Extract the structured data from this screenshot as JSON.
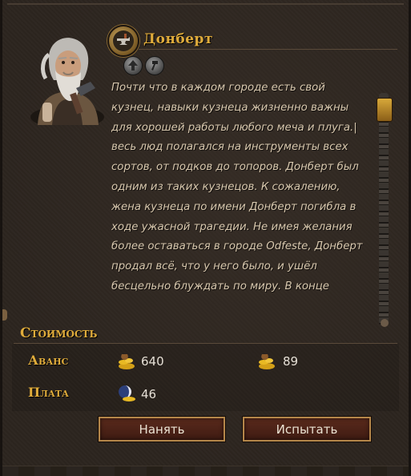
{
  "hero": {
    "name": "Донберт",
    "description": "Почти что в каждом городе есть свой кузнец, навыки кузнеца жизненно важны для хорошей работы любого меча и плуга.| весь люд полагался на инструменты всех сортов, от подков до топоров. Донберт был одним из таких кузнецов. К сожалению, жена кузнеца по имени Донберт погибла в ходе ужасной трагедии. Не имея желания более оставаться в городе Odfeste, Донберт продал всё, что у него было, и ушёл бесцельно блуждать по миру. В конце",
    "icons": [
      "anvil-emblem-icon",
      "upgrade-arrow-skill-icon",
      "hammer-skill-icon"
    ]
  },
  "cost": {
    "title": "Стоимость",
    "advance_label": "Аванс",
    "advance_gold": "640",
    "advance_gold_2": "89",
    "pay_label": "Плата",
    "pay_value": "46",
    "icons": [
      "gold-pile-icon",
      "gold-pile-icon",
      "day-night-gold-icon"
    ]
  },
  "buttons": {
    "hire": "Нанять",
    "test": "Испытать"
  },
  "colors": {
    "accent": "#e0ac3b",
    "text": "#d8c8ae",
    "button_bg": "#4a2216",
    "button_border": "#b5874a"
  }
}
